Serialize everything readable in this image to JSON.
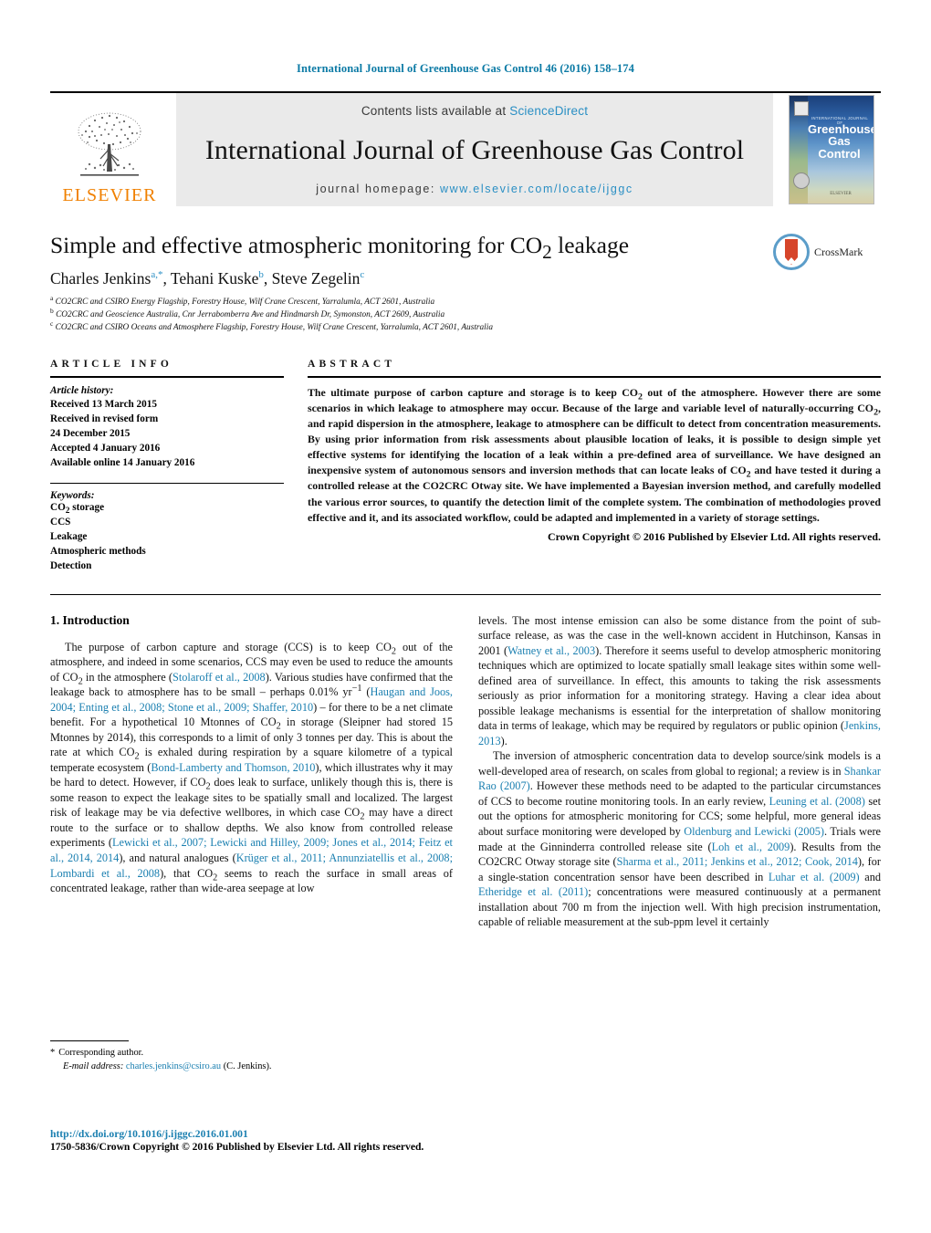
{
  "running_head": "International Journal of Greenhouse Gas Control 46 (2016) 158–174",
  "masthead": {
    "publisher_name": "ELSEVIER",
    "contents_prefix": "Contents lists available at ",
    "contents_link": "ScienceDirect",
    "journal_title": "International Journal of Greenhouse Gas Control",
    "homepage_prefix": "journal homepage: ",
    "homepage_url": "www.elsevier.com/locate/ijggc",
    "cover": {
      "supertitle": "INTERNATIONAL JOURNAL OF",
      "title_line1": "Greenhouse",
      "title_line2": "Gas Control",
      "footer": "ELSEVIER"
    }
  },
  "article": {
    "title_prefix": "Simple and effective atmospheric monitoring for CO",
    "title_sub": "2",
    "title_suffix": " leakage",
    "authors": [
      {
        "name": "Charles Jenkins",
        "marks": "a,*"
      },
      {
        "name": "Tehani Kuske",
        "marks": "b"
      },
      {
        "name": "Steve Zegelin",
        "marks": "c"
      }
    ],
    "affiliations": [
      {
        "mark": "a",
        "text": "CO2CRC and CSIRO Energy Flagship, Forestry House, Wilf Crane Crescent, Yarralumla, ACT 2601, Australia"
      },
      {
        "mark": "b",
        "text": "CO2CRC and Geoscience Australia, Cnr Jerrabomberra Ave and Hindmarsh Dr, Symonston, ACT 2609, Australia"
      },
      {
        "mark": "c",
        "text": "CO2CRC and CSIRO Oceans and Atmosphere Flagship, Forestry House, Wilf Crane Crescent, Yarralumla, ACT 2601, Australia"
      }
    ],
    "crossmark_label": "CrossMark"
  },
  "article_info": {
    "heading": "ARTICLE INFO",
    "history_label": "Article history:",
    "history": [
      "Received 13 March 2015",
      "Received in revised form",
      "24 December 2015",
      "Accepted 4 January 2016",
      "Available online 14 January 2016"
    ],
    "keywords_label": "Keywords:",
    "keywords": [
      "CO2 storage",
      "CCS",
      "Leakage",
      "Atmospheric methods",
      "Detection"
    ]
  },
  "abstract": {
    "heading": "ABSTRACT",
    "text": "The ultimate purpose of carbon capture and storage is to keep CO2 out of the atmosphere. However there are some scenarios in which leakage to atmosphere may occur. Because of the large and variable level of naturally-occurring CO2, and rapid dispersion in the atmosphere, leakage to atmosphere can be difficult to detect from concentration measurements. By using prior information from risk assessments about plausible location of leaks, it is possible to design simple yet effective systems for identifying the location of a leak within a pre-defined area of surveillance. We have designed an inexpensive system of autonomous sensors and inversion methods that can locate leaks of CO2 and have tested it during a controlled release at the CO2CRC Otway site. We have implemented a Bayesian inversion method, and carefully modelled the various error sources, to quantify the detection limit of the complete system. The combination of methodologies proved effective and it, and its associated workflow, could be adapted and implemented in a variety of storage settings.",
    "rights": "Crown Copyright © 2016 Published by Elsevier Ltd. All rights reserved."
  },
  "body": {
    "section_number_title": "1.  Introduction",
    "left_paragraph_html": "The purpose of carbon capture and storage (CCS) is to keep CO<sub>2</sub> out of the atmosphere, and indeed in some scenarios, CCS may even be used to reduce the amounts of CO<sub>2</sub> in the atmosphere (<span class=\"cite\">Stolaroff et al., 2008</span>). Various studies have confirmed that the leakage back to atmosphere has to be small – perhaps 0.01% yr<sup>−1</sup> (<span class=\"cite\">Haugan and Joos, 2004; Enting et al., 2008; Stone et al., 2009; Shaffer, 2010</span>) – for there to be a net climate benefit. For a hypothetical 10 Mtonnes of CO<sub>2</sub> in storage (Sleipner had stored 15 Mtonnes by 2014), this corresponds to a limit of only 3 tonnes per day. This is about the rate at which CO<sub>2</sub> is exhaled during respiration by a square kilometre of a typical temperate ecosystem (<span class=\"cite\">Bond-Lamberty and Thomson, 2010</span>), which illustrates why it may be hard to detect. However, if CO<sub>2</sub> does leak to surface, unlikely though this is, there is some reason to expect the leakage sites to be spatially small and localized. The largest risk of leakage may be via defective wellbores, in which case CO<sub>2</sub> may have a direct route to the surface or to shallow depths. We also know from controlled release experiments (<span class=\"cite\">Lewicki et al., 2007; Lewicki and Hilley, 2009; Jones et al., 2014; Feitz et al., 2014, 2014</span>), and natural analogues (<span class=\"cite\">Krüger et al., 2011; Annunziatellis et al., 2008; Lombardi et al., 2008</span>), that CO<sub>2</sub> seems to reach the surface in small areas of concentrated leakage, rather than wide-area seepage at low",
    "right_paragraph_1_html": "levels. The most intense emission can also be some distance from the point of sub-surface release, as was the case in the well-known accident in Hutchinson, Kansas in 2001 (<span class=\"cite\">Watney et al., 2003</span>). Therefore it seems useful to develop atmospheric monitoring techniques which are optimized to locate spatially small leakage sites within some well-defined area of surveillance. In effect, this amounts to taking the risk assessments seriously as prior information for a monitoring strategy. Having a clear idea about possible leakage mechanisms is essential for the interpretation of shallow monitoring data in terms of leakage, which may be required by regulators or public opinion (<span class=\"cite\">Jenkins, 2013</span>).",
    "right_paragraph_2_html": "The inversion of atmospheric concentration data to develop source/sink models is a well-developed area of research, on scales from global to regional; a review is in <span class=\"cite\">Shankar Rao (2007)</span>. However these methods need to be adapted to the particular circumstances of CCS to become routine monitoring tools. In an early review, <span class=\"cite\">Leuning et al. (2008)</span> set out the options for atmospheric monitoring for CCS; some helpful, more general ideas about surface monitoring were developed by <span class=\"cite\">Oldenburg and Lewicki (2005)</span>. Trials were made at the Ginninderra controlled release site (<span class=\"cite\">Loh et al., 2009</span>). Results from the CO2CRC Otway storage site (<span class=\"cite\">Sharma et al., 2011; Jenkins et al., 2012; Cook, 2014</span>), for a single-station concentration sensor have been described in <span class=\"cite\">Luhar et al. (2009)</span> and <span class=\"cite\">Etheridge et al. (2011)</span>; concentrations were measured continuously at a permanent installation about 700 m from the injection well. With high precision instrumentation, capable of reliable measurement at the sub-ppm level it certainly"
  },
  "footnotes": {
    "corresponding_star": "*",
    "corresponding_label": "Corresponding author.",
    "email_label": "E-mail address:",
    "email_address": "charles.jenkins@csiro.au",
    "email_suffix": "(C. Jenkins)."
  },
  "footer": {
    "doi": "http://dx.doi.org/10.1016/j.ijggc.2016.01.001",
    "issn_rights": "1750-5836/Crown Copyright © 2016 Published by Elsevier Ltd. All rights reserved."
  },
  "colors": {
    "link": "#1a7fb0",
    "running_head": "#0b7aa5",
    "elsevier_orange": "#f08000",
    "sciencedirect": "#2a8fc4"
  }
}
